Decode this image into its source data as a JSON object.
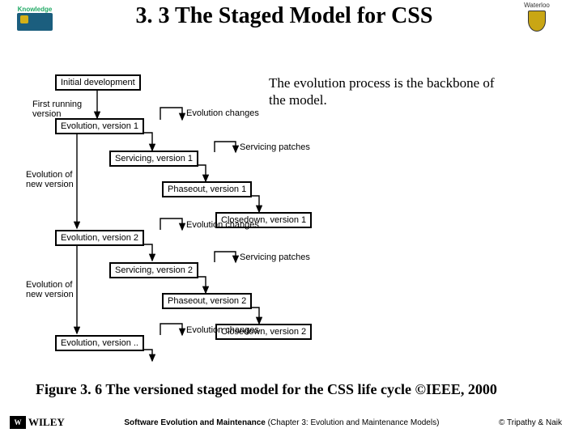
{
  "header": {
    "logo_left_text": "Knowledge",
    "title": "3. 3 The Staged Model for CSS",
    "logo_right_text": "Waterloo"
  },
  "description": "The evolution process is the backbone of the model.",
  "diagram": {
    "boxes": {
      "initial": "Initial development",
      "ev1": "Evolution, version 1",
      "sv1": "Servicing, version 1",
      "ph1": "Phaseout, version 1",
      "cd1": "Closedown, version 1",
      "ev2": "Evolution, version 2",
      "sv2": "Servicing, version 2",
      "ph2": "Phaseout, version 2",
      "cd2": "Closedown, version 2",
      "evn": "Evolution, version .."
    },
    "labels": {
      "first_running": "First running\nversion",
      "evo_changes": "Evolution changes",
      "servicing_patches": "Servicing patches",
      "evo_new_version": "Evolution of\nnew version"
    }
  },
  "caption": "Figure 3. 6 The versioned staged model for the CSS life cycle ©IEEE, 2000",
  "footer": {
    "wiley": "WILEY",
    "book_title": "Software Evolution and Maintenance",
    "chapter": " (Chapter 3: Evolution and Maintenance Models)",
    "copyright": "© Tripathy & Naik"
  }
}
